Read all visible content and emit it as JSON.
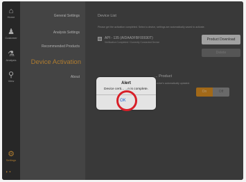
{
  "rail": {
    "items": [
      {
        "label": "Home",
        "icon": "home-icon"
      },
      {
        "label": "Customer",
        "icon": "customer-icon"
      },
      {
        "label": "Analysis",
        "icon": "flask-icon"
      },
      {
        "label": "View",
        "icon": "search-icon"
      },
      {
        "label": "Settings",
        "icon": "gear-icon"
      }
    ]
  },
  "menu": {
    "items": [
      "General Settings",
      "Analysis Settings",
      "Recommended Products",
      "Device Activation",
      "About"
    ],
    "active": "Device Activation"
  },
  "main": {
    "device_list": {
      "title": "Device List",
      "description": "Please get the activation completed. Select a device, settings are automatically saved to activate.",
      "device_name": "API - 135 (AIDAA0FBF00030T)",
      "device_status": "Verification Completed / Currently Connected Device",
      "download_label": "Product Download",
      "delete_label": "Delete"
    },
    "product": {
      "title": "... Product",
      "description": "...evice's automatically updated.",
      "on_label": "On",
      "off_label": "Off"
    }
  },
  "alert": {
    "title": "Alert",
    "message": "Device certi... ...n is complete.",
    "ok_label": "OK"
  },
  "colors": {
    "accent": "#e8a23a",
    "highlight": "#d81f28",
    "link": "#1a5fd0"
  }
}
